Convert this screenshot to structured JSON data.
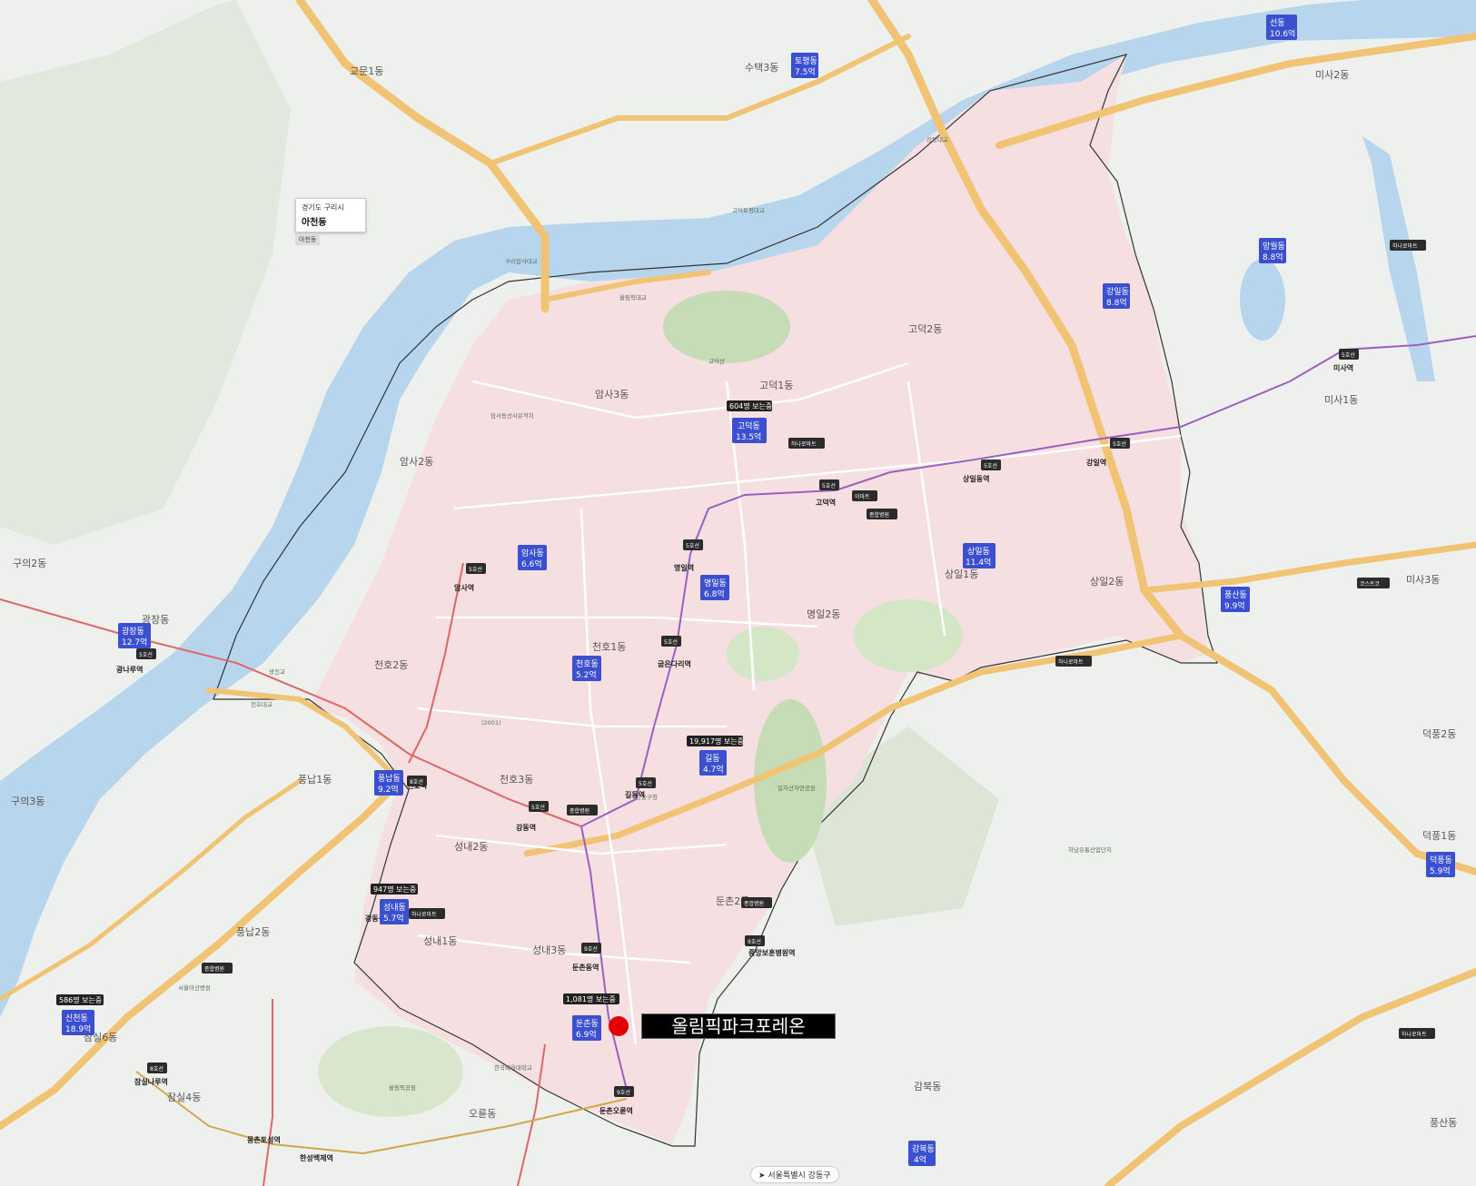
{
  "colors": {
    "land": "#eef0ed",
    "river": "#b8d5ee",
    "district": "#f6dfe0",
    "park": "#c5dcb6",
    "road_major": "#f1c475",
    "road_minor": "#ffffff",
    "metro_purple": "#9b5fc0",
    "metro_red": "#e06666",
    "badge": "#3b4fd1",
    "marker": "#e30000"
  },
  "info_card": {
    "region": "경기도 구리시",
    "name": "아천동",
    "tag": "아천동"
  },
  "target": {
    "label": "올림픽파크포레온"
  },
  "footer": {
    "text": "서울특별시 강동구"
  },
  "dong_labels": [
    {
      "text": "교문1동"
    },
    {
      "text": "수택3동"
    },
    {
      "text": "암사3동"
    },
    {
      "text": "암사2동"
    },
    {
      "text": "고덕1동"
    },
    {
      "text": "고덕2동"
    },
    {
      "text": "상일1동"
    },
    {
      "text": "상일2동"
    },
    {
      "text": "명일2동"
    },
    {
      "text": "천호1동"
    },
    {
      "text": "천호2동"
    },
    {
      "text": "천호3동"
    },
    {
      "text": "성내2동"
    },
    {
      "text": "성내1동"
    },
    {
      "text": "성내3동"
    },
    {
      "text": "둔촌2동"
    },
    {
      "text": "풍납1동"
    },
    {
      "text": "풍납2동"
    },
    {
      "text": "구의2동"
    },
    {
      "text": "구의3동"
    },
    {
      "text": "광장동"
    },
    {
      "text": "잠실6동"
    },
    {
      "text": "잠실4동"
    },
    {
      "text": "오륜동"
    },
    {
      "text": "미사1동"
    },
    {
      "text": "미사2동"
    },
    {
      "text": "미사3동"
    },
    {
      "text": "덕풍2동"
    },
    {
      "text": "덕풍1동"
    },
    {
      "text": "감북동"
    },
    {
      "text": "풍산동"
    }
  ],
  "price_badges": [
    {
      "name": "토평동",
      "price": "7.5억"
    },
    {
      "name": "선동",
      "price": "10.6억"
    },
    {
      "name": "망월동",
      "price": "8.8억"
    },
    {
      "name": "강일동",
      "price": "8.8억"
    },
    {
      "name": "고덕동",
      "price": "13.5억"
    },
    {
      "name": "상일동",
      "price": "11.4억"
    },
    {
      "name": "암사동",
      "price": "6.6억"
    },
    {
      "name": "명일동",
      "price": "6.8억"
    },
    {
      "name": "천호동",
      "price": "5.2억"
    },
    {
      "name": "길동",
      "price": "4.7억"
    },
    {
      "name": "풍납동",
      "price": "9.2억"
    },
    {
      "name": "성내동",
      "price": "5.7억"
    },
    {
      "name": "둔촌동",
      "price": "6.9억"
    },
    {
      "name": "광장동",
      "price": "12.7억"
    },
    {
      "name": "신천동",
      "price": "18.9억"
    },
    {
      "name": "풍산동",
      "price": "9.9억"
    },
    {
      "name": "덕풍동",
      "price": "5.9억"
    },
    {
      "name": "감북동",
      "price": "4억"
    }
  ],
  "viewer_tags": [
    {
      "text": "604명 보는중"
    },
    {
      "text": "19,917명 보는중"
    },
    {
      "text": "947명 보는중"
    },
    {
      "text": "1,081명 보는중"
    },
    {
      "text": "586명 보는중"
    }
  ],
  "stations": [
    {
      "text": "암사역"
    },
    {
      "text": "명일역"
    },
    {
      "text": "굽은다리역"
    },
    {
      "text": "길동역"
    },
    {
      "text": "강동역"
    },
    {
      "text": "천호역"
    },
    {
      "text": "둔촌동역"
    },
    {
      "text": "고덕역"
    },
    {
      "text": "상일동역"
    },
    {
      "text": "강일역"
    },
    {
      "text": "미사역"
    },
    {
      "text": "광나루역"
    },
    {
      "text": "잠실나루역"
    },
    {
      "text": "몽촌토성역"
    },
    {
      "text": "한성백제역"
    },
    {
      "text": "둔촌오륜역"
    },
    {
      "text": "중앙보훈병원역"
    },
    {
      "text": "강동구청역"
    }
  ],
  "pins": [
    {
      "text": "5호선"
    },
    {
      "text": "8호선"
    },
    {
      "text": "9호선"
    },
    {
      "text": "종합병원"
    },
    {
      "text": "하나로마트"
    },
    {
      "text": "이마트"
    },
    {
      "text": "코스트코"
    }
  ],
  "pois": [
    {
      "text": "광진교"
    },
    {
      "text": "천호대교"
    },
    {
      "text": "올림픽대교"
    },
    {
      "text": "구리암사대교"
    },
    {
      "text": "강동대교"
    },
    {
      "text": "고덕토평대교"
    },
    {
      "text": "암사동선사유적지"
    },
    {
      "text": "강동구청"
    },
    {
      "text": "올림픽공원"
    },
    {
      "text": "서울아산병원"
    },
    {
      "text": "일자산자연공원"
    },
    {
      "text": "고덕산"
    },
    {
      "text": "하남유통산업단지"
    },
    {
      "text": "한국체육대학교"
    },
    {
      "text": "(2001)"
    }
  ]
}
